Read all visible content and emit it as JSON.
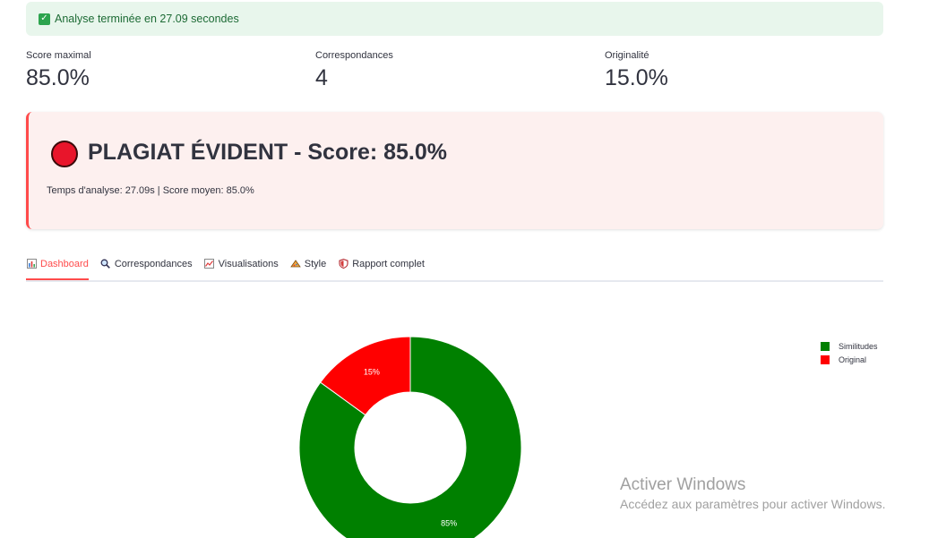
{
  "status": {
    "message": "Analyse terminée en 27.09 secondes",
    "icon": "check-icon"
  },
  "metrics": [
    {
      "label": "Score maximal",
      "value": "85.0%"
    },
    {
      "label": "Correspondances",
      "value": "4"
    },
    {
      "label": "Originalité",
      "value": "15.0%"
    }
  ],
  "alert": {
    "title": "PLAGIAT ÉVIDENT - Score: 85.0%",
    "subtitle": "Temps d'analyse: 27.09s | Score moyen: 85.0%",
    "color": "#e8152b"
  },
  "tabs": [
    {
      "label": "Dashboard",
      "icon": "bar-chart-icon",
      "active": true
    },
    {
      "label": "Correspondances",
      "icon": "magnifier-icon",
      "active": false
    },
    {
      "label": "Visualisations",
      "icon": "line-chart-icon",
      "active": false
    },
    {
      "label": "Style",
      "icon": "palette-icon",
      "active": false
    },
    {
      "label": "Rapport complet",
      "icon": "shield-icon",
      "active": false
    }
  ],
  "chart_data": {
    "type": "pie",
    "donut": true,
    "slices": [
      {
        "label": "Similitudes",
        "value": 85,
        "text": "85%",
        "color": "#008000"
      },
      {
        "label": "Original",
        "value": 15,
        "text": "15%",
        "color": "#ff0000"
      }
    ],
    "legend_position": "top-right"
  },
  "watermark": {
    "title": "Activer Windows",
    "subtitle": "Accédez aux paramètres pour activer Windows."
  }
}
